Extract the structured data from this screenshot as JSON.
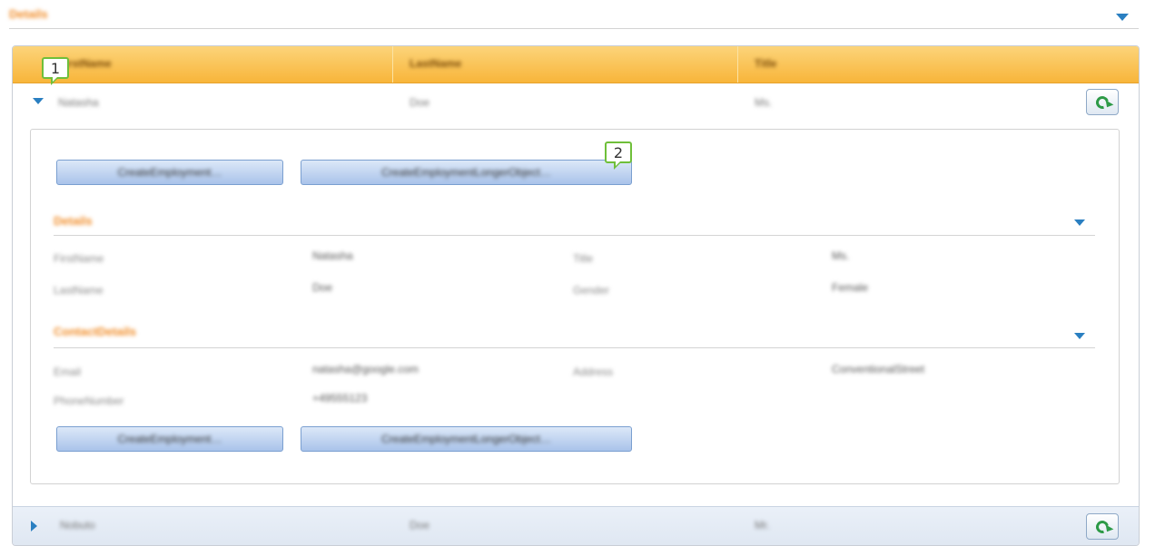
{
  "top_section": {
    "title": "Details"
  },
  "grid": {
    "columns": [
      "FirstName",
      "LastName",
      "Title"
    ],
    "rows": [
      {
        "first": "Natasha",
        "last": "Doe",
        "title": "Ms."
      },
      {
        "first": "Nobuto",
        "last": "Doe",
        "title": "Mr."
      }
    ]
  },
  "detail": {
    "top_buttons": [
      "CreateEmployment…",
      "CreateEmploymentLongerObject…"
    ],
    "bottom_buttons": [
      "CreateEmployment…",
      "CreateEmploymentLongerObject…"
    ],
    "details_section": {
      "title": "Details",
      "fields": [
        {
          "label": "FirstName",
          "value": "Natasha",
          "label2": "Title",
          "value2": "Ms."
        },
        {
          "label": "LastName",
          "value": "Doe",
          "label2": "Gender",
          "value2": "Female"
        }
      ]
    },
    "contact_section": {
      "title": "ContactDetails",
      "fields": [
        {
          "label": "Email",
          "value": "natasha@google.com",
          "label2": "Address",
          "value2": "ConventionalStreet"
        },
        {
          "label": "PhoneNumber",
          "value": "+49555123",
          "label2": "",
          "value2": ""
        }
      ]
    }
  },
  "callouts": [
    "1",
    "2"
  ],
  "icons": {
    "expand": "chevron-down-icon",
    "collapse": "chevron-right-icon",
    "refresh": "refresh-icon"
  },
  "colors": {
    "header_orange": "#f8b53a",
    "accent_blue": "#2a7fc1",
    "section_title": "#f08a24",
    "callout_green": "#6fbf3a"
  }
}
